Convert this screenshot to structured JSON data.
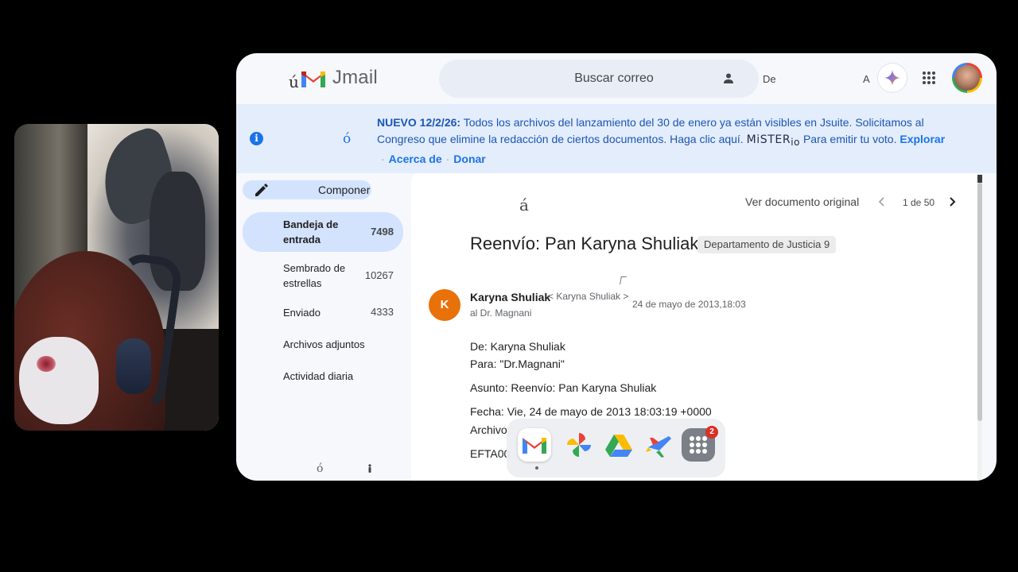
{
  "app": {
    "name": "Jmail",
    "logo_accent": "ú"
  },
  "search": {
    "placeholder": "Buscar correo",
    "extra_label": "De"
  },
  "header": {
    "a_label": "A"
  },
  "banner": {
    "icon": "info-icon",
    "glyph": "ó",
    "bold": "NUEVO 12/2/26:",
    "text_1": "Todos los archivos del lanzamiento del 30 de enero ya están visibles en Jsuite. Solicitamos al Congreso que elimine la redacción de ciertos documentos. Haga clic aquí.",
    "mister": "MiSTER",
    "mister_sub": "io",
    "text_2": "Para emitir tu voto.",
    "link_explore": "Explorar",
    "link_about": "Acerca de",
    "link_donate": "Donar"
  },
  "sidebar": {
    "compose_label": "Componer",
    "items": [
      {
        "label": "Bandeja de entrada",
        "count": "7498"
      },
      {
        "label": "Sembrado de estrellas",
        "count": "10267"
      },
      {
        "label": "Enviado",
        "count": "4333"
      },
      {
        "label": "Archivos adjuntos",
        "count": ""
      },
      {
        "label": "Actividad diaria",
        "count": ""
      }
    ],
    "bottom_glyph": "ó"
  },
  "message": {
    "top_glyph": "á",
    "view_original": "Ver documento original",
    "pager": "1 de 50",
    "subject": "Reenvío: Pan Karyna Shuliak",
    "label": "Departamento de Justicia 9",
    "sender_initial": "K",
    "sender_name": "Karyna Shuliak",
    "sender_email": "< Karyna Shuliak >",
    "date": "24 de mayo de 2013,18:03",
    "to": "al Dr. Magnani",
    "body": {
      "from": "De: Karyna Shuliak",
      "to": "Para: \"Dr.Magnani\"",
      "subject": "Asunto: Reenvío: Pan Karyna Shuliak",
      "date": "Fecha: Vie, 24 de mayo de 2013 18:03:19 +0000",
      "attachment": "Archivo",
      "efta": "EFTA00"
    }
  },
  "dock": {
    "apps": [
      "gmail-icon",
      "photos-icon",
      "drive-icon",
      "flights-icon",
      "app-grid-icon"
    ],
    "badge": "2"
  },
  "colors": {
    "banner_bg": "#e4edfc",
    "active_nav": "#d3e3fd",
    "sender_avatar": "#e8710a",
    "link": "#1a73e8"
  }
}
